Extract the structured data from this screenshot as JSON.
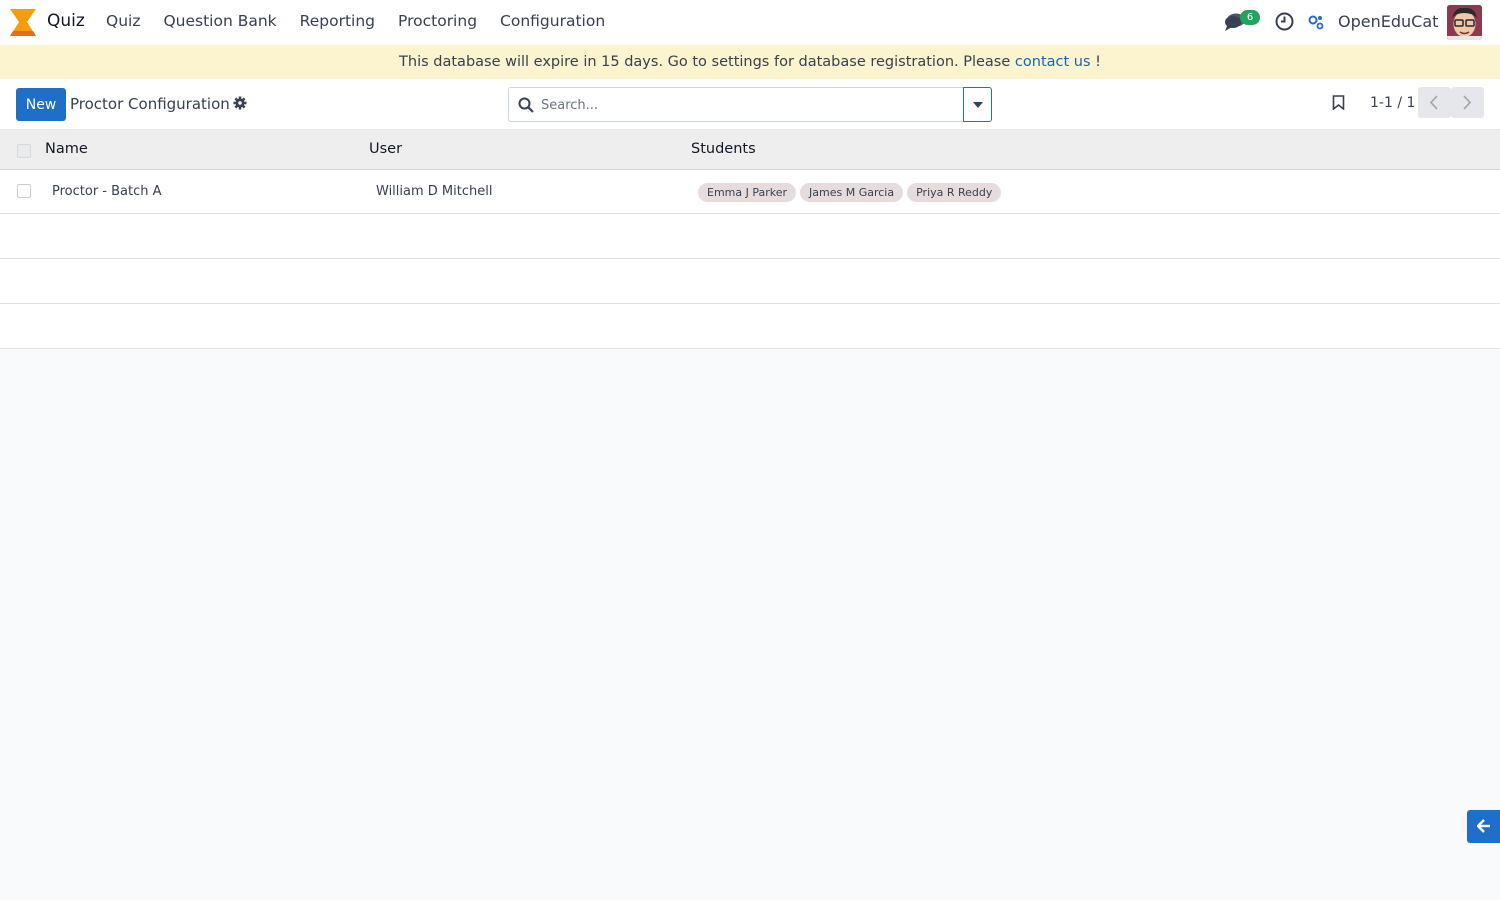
{
  "navbar": {
    "app_name": "Quiz",
    "menu": [
      "Quiz",
      "Question Bank",
      "Reporting",
      "Proctoring",
      "Configuration"
    ],
    "chat_badge": "6",
    "company": "OpenEduCat",
    "logo_color": "#f59e0b"
  },
  "banner": {
    "text": "This database will expire in 15 days. Go to settings for database registration. Please ",
    "link": "contact us",
    "suffix": " !"
  },
  "control_panel": {
    "new_label": "New",
    "breadcrumb": "Proctor Configuration",
    "search_placeholder": "Search...",
    "pager": "1-1 / 1"
  },
  "table": {
    "columns": [
      "Name",
      "User",
      "Students"
    ],
    "rows": [
      {
        "name": "Proctor - Batch A",
        "user": "William D Mitchell",
        "students": [
          "Emma J Parker",
          "James M Garcia",
          "Priya R Reddy"
        ]
      }
    ]
  },
  "colors": {
    "primary": "#1f6fc8",
    "banner_bg": "#fcf3cf",
    "badge_green": "#22a45d"
  }
}
